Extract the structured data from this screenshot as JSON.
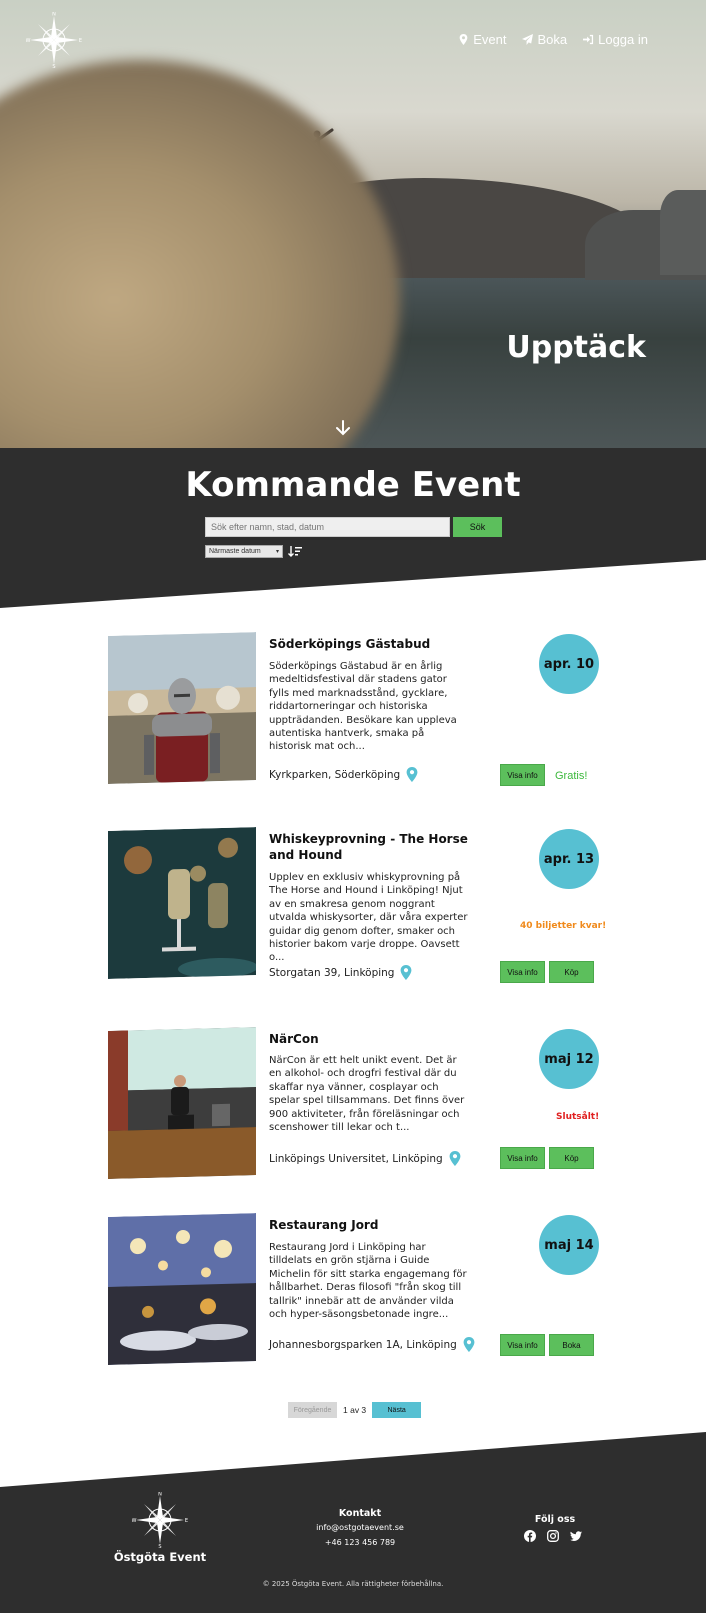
{
  "nav": {
    "items": [
      {
        "label": "Event",
        "icon": "map-pin-icon"
      },
      {
        "label": "Boka",
        "icon": "paper-plane-icon"
      },
      {
        "label": "Logga in",
        "icon": "sign-in-icon"
      }
    ]
  },
  "hero": {
    "title": "Upptäck"
  },
  "section": {
    "title": "Kommande Event",
    "search_placeholder": "Sök efter namn, stad, datum",
    "search_button": "Sök",
    "sort_selected": "Närmaste datum"
  },
  "events": [
    {
      "name": "Söderköpings Gästabud",
      "description": "Söderköpings Gästabud är en årlig medeltidsfestival där stadens gator fylls med marknadsstånd, gycklare, riddartorneringar och historiska uppträdanden. Besökare kan uppleva autentiska hantverk, smaka på historisk mat och...",
      "location": "Kyrkparken, Söderköping",
      "date": "apr. 10",
      "info_button": "Visa info",
      "action_button": "",
      "status": "Gratis!"
    },
    {
      "name": "Whiskeyprovning - The Horse and Hound",
      "description": "Upplev en exklusiv whiskyprovning på The Horse and Hound i Linköping! Njut av en smakresa genom noggrant utvalda whiskysorter, där våra experter guidar dig genom dofter, smaker och historier bakom varje droppe. Oavsett o...",
      "location": "Storgatan 39, Linköping",
      "date": "apr. 13",
      "info_button": "Visa info",
      "action_button": "Köp",
      "status": "40 biljetter kvar!"
    },
    {
      "name": "NärCon",
      "description": "NärCon är ett helt unikt event. Det är en alkohol- och drogfri festival där du skaffar nya vänner, cosplayar och spelar spel tillsammans. Det finns över 900 aktiviteter, från föreläsningar och scenshower till lekar och t...",
      "location": "Linköpings Universitet, Linköping",
      "date": "maj 12",
      "info_button": "Visa info",
      "action_button": "Köp",
      "status": "Slutsålt!"
    },
    {
      "name": "Restaurang Jord",
      "description": "Restaurang Jord i Linköping har tilldelats en grön stjärna i Guide Michelin för sitt starka engagemang för hållbarhet. Deras filosofi \"från skog till tallrik\" innebär att de använder vilda och hyper-säsongsbetonade ingre...",
      "location": "Johannesborgsparken 1A, Linköping",
      "date": "maj 14",
      "info_button": "Visa info",
      "action_button": "Boka",
      "status": ""
    }
  ],
  "pagination": {
    "prev": "Föregående",
    "position": "1 av 3",
    "next": "Nästa"
  },
  "footer": {
    "brand": "Östgöta Event",
    "contact_heading": "Kontakt",
    "email": "info@ostgotaevent.se",
    "phone": "+46 123 456 789",
    "follow_heading": "Följ oss",
    "social": [
      "facebook-icon",
      "instagram-icon",
      "twitter-icon"
    ],
    "copyright": "© 2025 Östgöta Event. Alla rättigheter förbehållna."
  },
  "colors": {
    "accent_teal": "#57c0d2",
    "button_green": "#5cbf5c",
    "status_free": "#3cb83c",
    "status_few": "#f08a1c",
    "status_soldout": "#e02020",
    "dark": "#2e2e2e"
  }
}
